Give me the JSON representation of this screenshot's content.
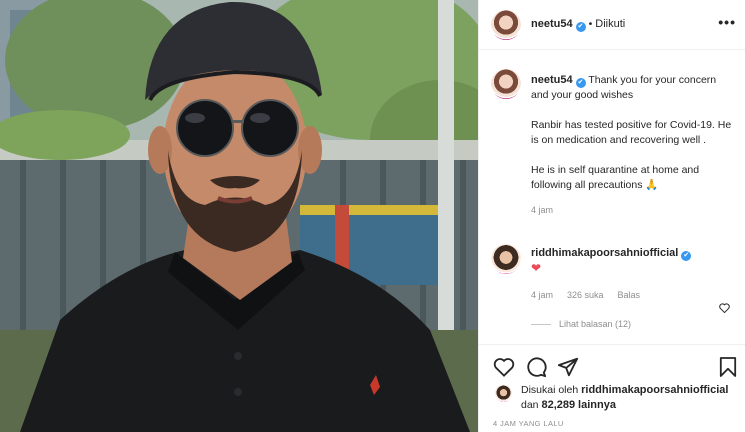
{
  "post": {
    "username": "neetu54",
    "verified_mark": "✔",
    "separator": "•",
    "follow_status": "Diikuti",
    "more_icon": "•••"
  },
  "caption": {
    "username": "neetu54",
    "line1": "Thank you for your concern and your good wishes",
    "line2": "Ranbir has tested positive for Covid-19. He is on medication and recovering well .",
    "line3": "He is in self quarantine at home and following all precautions 🙏",
    "age": "4 jam"
  },
  "comment": {
    "username": "riddhimakapoorsahniofficial",
    "text": "❤",
    "age": "4 jam",
    "likes": "326 suka",
    "reply": "Balas",
    "view_replies": "Lihat balasan (12)"
  },
  "actions": {
    "icons": [
      "heart-icon",
      "comment-icon",
      "share-icon",
      "bookmark-icon"
    ]
  },
  "likes": {
    "prefix": "Disukai oleh",
    "user": "riddhimakapoorsahniofficial",
    "and": "dan",
    "count": "82,289",
    "suffix": "lainnya"
  },
  "timestamp": "4 JAM YANG LALU",
  "colors": {
    "verified": "#3897f0",
    "heart": "#ed4956",
    "muted": "#8e8e8e"
  }
}
